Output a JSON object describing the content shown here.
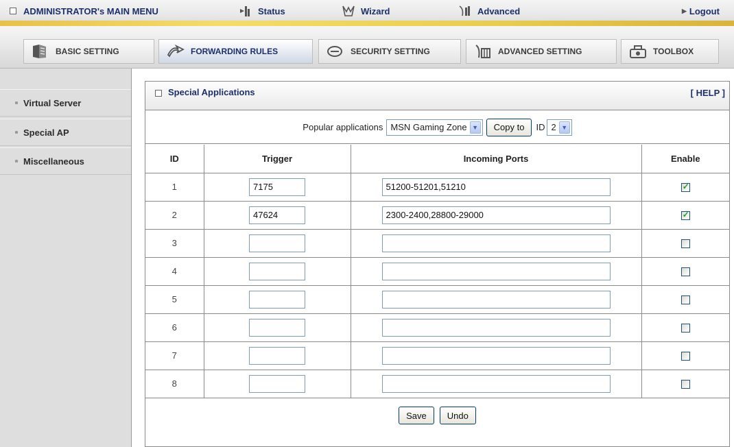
{
  "top_menu": {
    "title": "ADMINISTRATOR's MAIN MENU",
    "status": "Status",
    "wizard": "Wizard",
    "advanced": "Advanced",
    "logout": "Logout"
  },
  "tabs": [
    {
      "label": "BASIC SETTING",
      "icon": "folder-icon",
      "active": false
    },
    {
      "label": "FORWARDING RULES",
      "icon": "forward-arrow-icon",
      "active": true
    },
    {
      "label": "SECURITY SETTING",
      "icon": "lock-icon",
      "active": false
    },
    {
      "label": "ADVANCED SETTING",
      "icon": "server-icon",
      "active": false
    },
    {
      "label": "TOOLBOX",
      "icon": "toolbox-icon",
      "active": false
    }
  ],
  "sidebar": {
    "items": [
      {
        "label": "Virtual Server"
      },
      {
        "label": "Special AP"
      },
      {
        "label": "Miscellaneous"
      }
    ]
  },
  "panel": {
    "title": "Special Applications",
    "help": "[ HELP ]",
    "popular_label": "Popular applications",
    "popular_selected": "MSN Gaming Zone",
    "copy_button": "Copy to",
    "id_label": "ID",
    "id_selected": "2"
  },
  "table": {
    "headers": {
      "id": "ID",
      "trigger": "Trigger",
      "ports": "Incoming Ports",
      "enable": "Enable"
    },
    "rows": [
      {
        "id": "1",
        "trigger": "7175",
        "ports": "51200-51201,51210",
        "enabled": true
      },
      {
        "id": "2",
        "trigger": "47624",
        "ports": "2300-2400,28800-29000",
        "enabled": true
      },
      {
        "id": "3",
        "trigger": "",
        "ports": "",
        "enabled": false
      },
      {
        "id": "4",
        "trigger": "",
        "ports": "",
        "enabled": false
      },
      {
        "id": "5",
        "trigger": "",
        "ports": "",
        "enabled": false
      },
      {
        "id": "6",
        "trigger": "",
        "ports": "",
        "enabled": false
      },
      {
        "id": "7",
        "trigger": "",
        "ports": "",
        "enabled": false
      },
      {
        "id": "8",
        "trigger": "",
        "ports": "",
        "enabled": false
      }
    ]
  },
  "buttons": {
    "save": "Save",
    "undo": "Undo"
  },
  "colors": {
    "accent_text": "#1c2f6b",
    "stripe": "#f4dc6a",
    "check": "#21a121"
  }
}
